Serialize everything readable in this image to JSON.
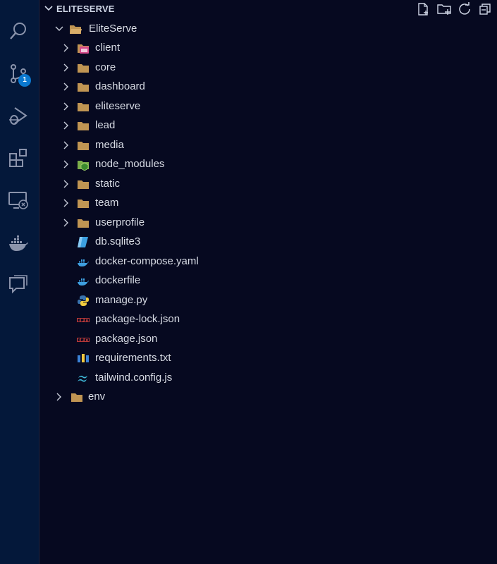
{
  "explorer": {
    "section_title": "ELITESERVE",
    "root_folder": "EliteServe",
    "items": [
      {
        "label": "client",
        "kind": "folder",
        "icon": "client-folder-icon"
      },
      {
        "label": "core",
        "kind": "folder",
        "icon": "folder-icon"
      },
      {
        "label": "dashboard",
        "kind": "folder",
        "icon": "folder-icon"
      },
      {
        "label": "eliteserve",
        "kind": "folder",
        "icon": "folder-icon"
      },
      {
        "label": "lead",
        "kind": "folder",
        "icon": "folder-icon"
      },
      {
        "label": "media",
        "kind": "folder",
        "icon": "folder-icon"
      },
      {
        "label": "node_modules",
        "kind": "folder",
        "icon": "node-folder-icon"
      },
      {
        "label": "static",
        "kind": "folder",
        "icon": "folder-icon"
      },
      {
        "label": "team",
        "kind": "folder",
        "icon": "folder-icon"
      },
      {
        "label": "userprofile",
        "kind": "folder",
        "icon": "folder-icon"
      },
      {
        "label": "db.sqlite3",
        "kind": "file",
        "icon": "database-file-icon"
      },
      {
        "label": "docker-compose.yaml",
        "kind": "file",
        "icon": "docker-icon"
      },
      {
        "label": "dockerfile",
        "kind": "file",
        "icon": "docker-icon"
      },
      {
        "label": "manage.py",
        "kind": "file",
        "icon": "python-icon"
      },
      {
        "label": "package-lock.json",
        "kind": "file",
        "icon": "npm-icon"
      },
      {
        "label": "package.json",
        "kind": "file",
        "icon": "npm-icon"
      },
      {
        "label": "requirements.txt",
        "kind": "file",
        "icon": "pip-icon"
      },
      {
        "label": "tailwind.config.js",
        "kind": "file",
        "icon": "tailwind-icon"
      }
    ],
    "sibling_folder": "env"
  },
  "activity_bar": {
    "source_control_badge": "1"
  },
  "colors": {
    "background": "#060920",
    "activity_bar": "#04183a",
    "badge": "#0b79d0",
    "folder": "#c09553",
    "text": "#d7dbe4"
  }
}
